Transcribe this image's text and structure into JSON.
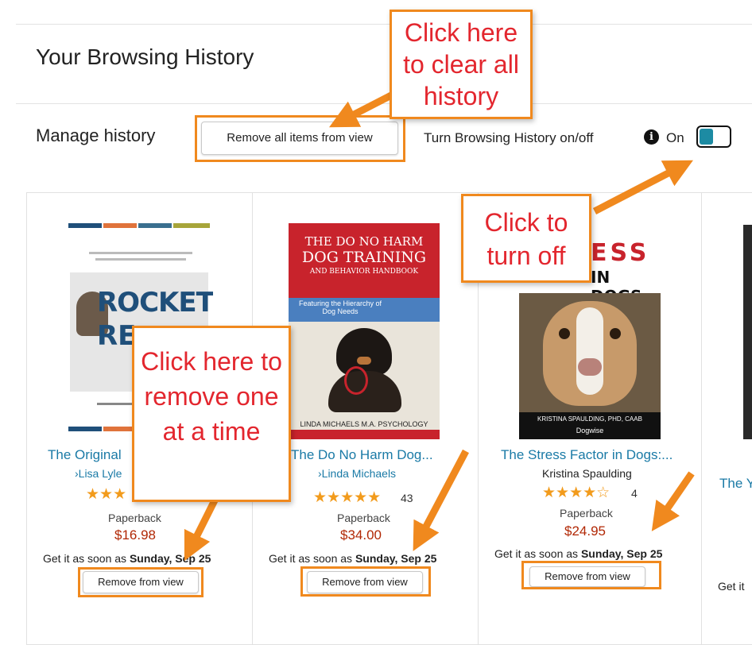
{
  "page_title": "Your Browsing History",
  "manage": {
    "label": "Manage history",
    "remove_all_label": "Remove all items from view",
    "toggle_label": "Turn Browsing History on/off",
    "info_glyph": "i",
    "toggle_state": "On"
  },
  "callouts": {
    "clear_all": "Click here to clear all history",
    "turn_off": "Click to turn off",
    "remove_one": "Click here to remove one at a time"
  },
  "products": [
    {
      "title": "The Original",
      "author": "›Lisa Lyle",
      "stars": "★★★",
      "rating_count": "",
      "format": "Paperback",
      "price": "$16.98",
      "delivery_prefix": "Get it as soon as",
      "delivery_date": "Sunday, Sep 25",
      "remove_label": "Remove from view",
      "cover": {
        "heading": "ROCKET",
        "heading2": "RE"
      }
    },
    {
      "title": "The Do No Harm Dog...",
      "author": "›Linda Michaels",
      "stars": "★★★★★",
      "rating_count": "43",
      "format": "Paperback",
      "price": "$34.00",
      "delivery_prefix": "Get it as soon as",
      "delivery_date": "Sunday, Sep 25",
      "remove_label": "Remove from view",
      "cover": {
        "line1": "THE DO NO HARM",
        "line2": "DOG TRAINING",
        "line3": "AND BEHAVIOR HANDBOOK",
        "line4": "Featuring the Hierarchy of Dog Needs",
        "author": "LINDA MICHAELS M.A. PSYCHOLOGY"
      }
    },
    {
      "title": "The Stress Factor in Dogs:...",
      "author": "Kristina Spaulding",
      "stars": "★★★★☆",
      "rating_count": "4",
      "format": "Paperback",
      "price": "$24.95",
      "delivery_prefix": "Get it as soon as",
      "delivery_date": "Sunday, Sep 25",
      "remove_label": "Remove from view",
      "cover": {
        "heading": "ESS",
        "sub": "IN DOGS",
        "author": "KRISTINA SPAULDING, PHD, CAAB",
        "publisher": "Dogwise"
      }
    },
    {
      "title": "The Y",
      "delivery_prefix": "Get it"
    }
  ],
  "colors": {
    "accent_orange": "#f0891e",
    "callout_text": "#e3262e",
    "link": "#1a7aa6",
    "price": "#b12704",
    "star": "#f29b1c",
    "toggle": "#1d8ba3"
  }
}
